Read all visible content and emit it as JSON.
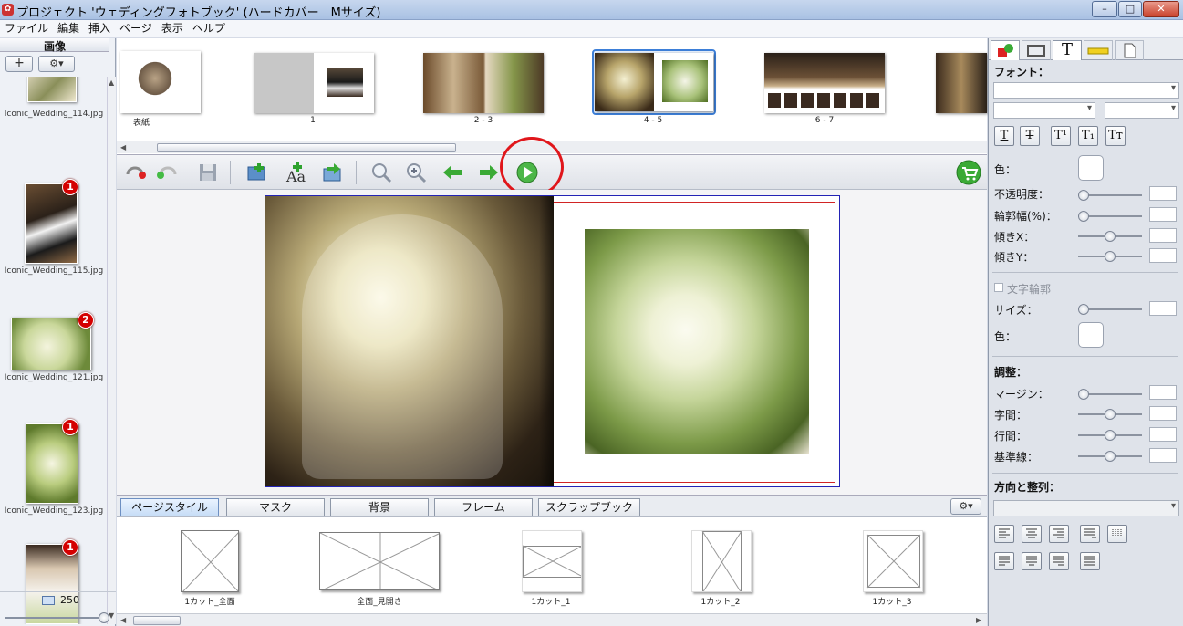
{
  "window": {
    "title": "プロジェクト 'ウェディングフォトブック' (ハードカバー　Mサイズ)",
    "minimize": "–",
    "maximize": "□",
    "close": "✕"
  },
  "menu": [
    "ファイル",
    "編集",
    "挿入",
    "ページ",
    "表示",
    "ヘルプ"
  ],
  "images_panel": {
    "title": "画像",
    "add_label": "+",
    "gear_label": "⚙▾",
    "count": "250",
    "items": [
      {
        "filename": "Iconic_Wedding_114.jpg",
        "badge": ""
      },
      {
        "filename": "Iconic_Wedding_115.jpg",
        "badge": "1"
      },
      {
        "filename": "Iconic_Wedding_121.jpg",
        "badge": "2"
      },
      {
        "filename": "Iconic_Wedding_123.jpg",
        "badge": "1"
      },
      {
        "filename": "",
        "badge": "1"
      }
    ]
  },
  "pages_strip": [
    {
      "label": "表紙"
    },
    {
      "label": "1"
    },
    {
      "label": "2 - 3"
    },
    {
      "label": "4 - 5"
    },
    {
      "label": "6 - 7"
    }
  ],
  "toolbar": {
    "icons": [
      "undo-icon",
      "redo-icon",
      "save-icon",
      "add-image-icon",
      "add-text-icon",
      "import-icon",
      "zoom-out-icon",
      "zoom-in-icon",
      "previous-page-icon",
      "next-page-icon",
      "play-icon",
      "cart-icon"
    ]
  },
  "tabs": [
    "ページスタイル",
    "マスク",
    "背景",
    "フレーム",
    "スクラップブック"
  ],
  "templates": [
    {
      "name": "1カット_全面"
    },
    {
      "name": "全面_見開き"
    },
    {
      "name": "1カット_1"
    },
    {
      "name": "1カット_2"
    },
    {
      "name": "1カット_3"
    }
  ],
  "right_panel": {
    "font_header": "フォント：",
    "format_buttons": [
      "T",
      "T",
      "T¹",
      "T₁",
      "Tт"
    ],
    "color_label": "色：",
    "opacity_label": "不透明度：",
    "outline_width_label": "輪郭幅(%)：",
    "skew_x_label": "傾きX：",
    "skew_y_label": "傾きY：",
    "text_outline_label": "文字輪郭",
    "size_label": "サイズ：",
    "color2_label": "色：",
    "adjust_header": "調整：",
    "margin_label": "マージン：",
    "char_spacing_label": "字間：",
    "line_spacing_label": "行間：",
    "baseline_label": "基準線：",
    "align_header": "方向と整列："
  },
  "colors": {
    "highlight_circle": "#e0161b",
    "selection_blue": "#3d7fd8",
    "accent_green": "#3aaa35"
  }
}
